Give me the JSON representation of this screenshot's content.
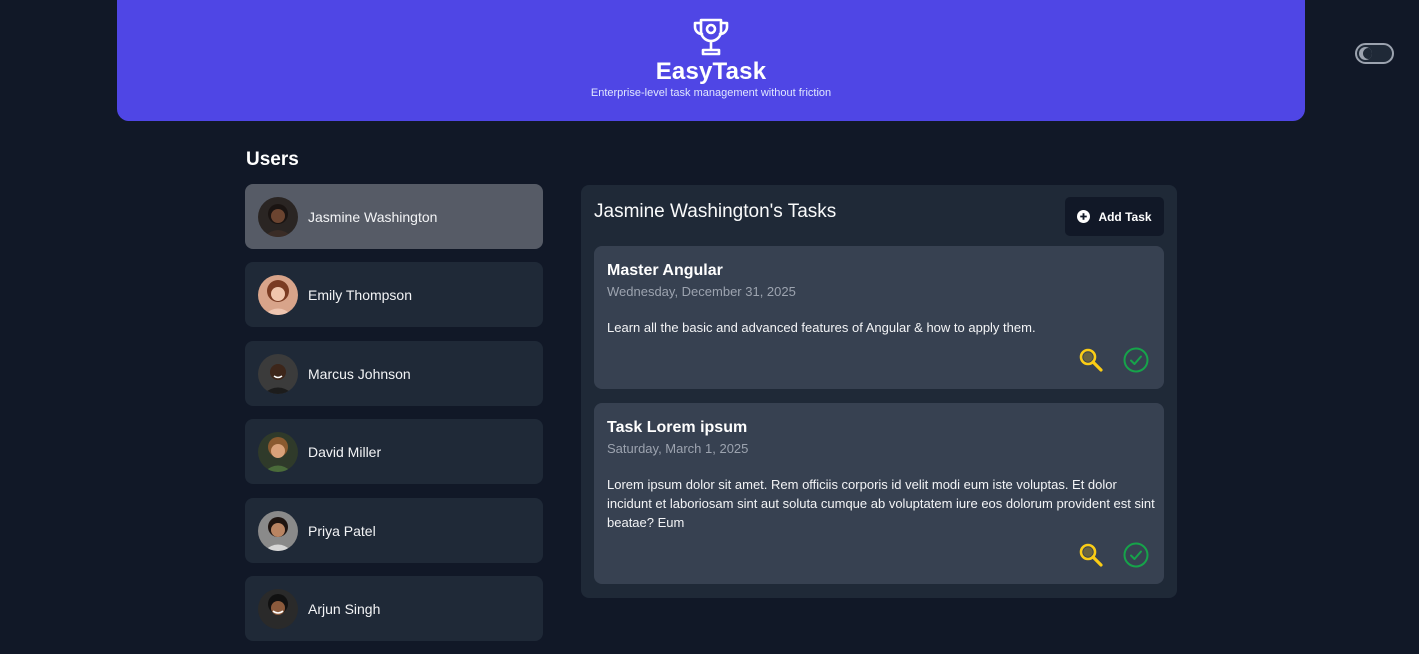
{
  "header": {
    "title": "EasyTask",
    "subtitle": "Enterprise-level task management without friction",
    "trophy_icon": "trophy-icon",
    "brand_color": "#4f46e5"
  },
  "theme_toggle": {
    "icon": "theme-toggle-icon",
    "state": "off"
  },
  "users": {
    "title": "Users",
    "items": [
      {
        "name": "Jasmine Washington",
        "selected": true
      },
      {
        "name": "Emily Thompson",
        "selected": false
      },
      {
        "name": "Marcus Johnson",
        "selected": false
      },
      {
        "name": "David Miller",
        "selected": false
      },
      {
        "name": "Priya Patel",
        "selected": false
      },
      {
        "name": "Arjun Singh",
        "selected": false
      }
    ]
  },
  "tasks": {
    "title": "Jasmine Washington's Tasks",
    "add_label": "Add Task",
    "items": [
      {
        "title": "Master Angular",
        "date": "Wednesday, December 31, 2025",
        "description": "Learn all the basic and advanced features of Angular & how to apply them."
      },
      {
        "title": "Task Lorem ipsum",
        "date": "Saturday, March 1, 2025",
        "description": "Lorem ipsum dolor sit amet. Rem officiis corporis id velit modi eum iste voluptas. Et dolor incidunt et laboriosam sint aut soluta cumque ab voluptatem iure eos dolorum provident est sint beatae? Eum"
      }
    ],
    "view_icon_color": "#facc15",
    "complete_icon_color": "#16a34a"
  }
}
